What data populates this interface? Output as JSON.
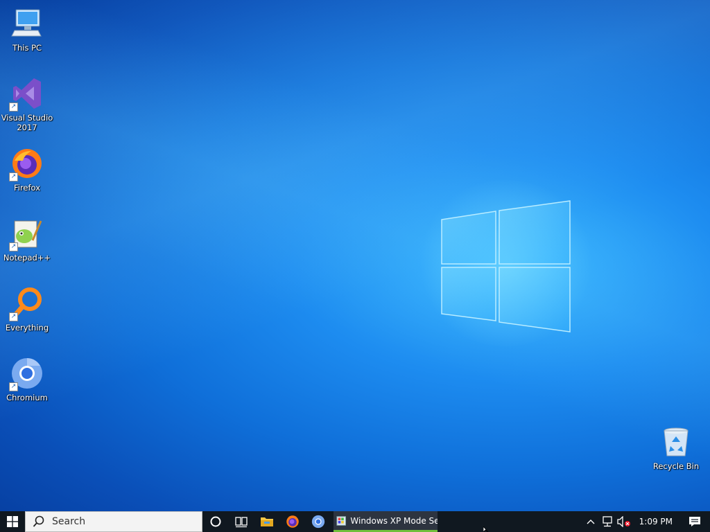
{
  "desktop": {
    "icons": [
      {
        "label": "This PC",
        "icon": "computer-icon"
      },
      {
        "label": "Visual Studio 2017",
        "icon": "visual-studio-icon"
      },
      {
        "label": "Firefox",
        "icon": "firefox-icon"
      },
      {
        "label": "Notepad++",
        "icon": "notepad-plus-plus-icon"
      },
      {
        "label": "Everything",
        "icon": "everything-search-icon"
      },
      {
        "label": "Chromium",
        "icon": "chromium-icon"
      }
    ],
    "recycle_bin": {
      "label": "Recycle Bin",
      "icon": "recycle-bin-icon"
    }
  },
  "taskbar": {
    "search_placeholder": "Search",
    "pinned": [
      {
        "name": "cortana",
        "icon": "cortana-circle-icon"
      },
      {
        "name": "task-view",
        "icon": "task-view-icon"
      },
      {
        "name": "file-explorer",
        "icon": "folder-icon"
      },
      {
        "name": "firefox",
        "icon": "firefox-icon"
      },
      {
        "name": "chromium",
        "icon": "chromium-icon"
      }
    ],
    "running_task": {
      "title": "Windows XP Mode Se...",
      "icon": "xp-mode-icon"
    },
    "tray": {
      "time": "1:09 PM",
      "icons": [
        "chevron-up-icon",
        "network-icon",
        "volume-muted-icon"
      ]
    }
  },
  "colors": {
    "taskbar": "#101820",
    "accent_underline": "#6fbf3a",
    "wallpaper": "#0f6fd9"
  }
}
